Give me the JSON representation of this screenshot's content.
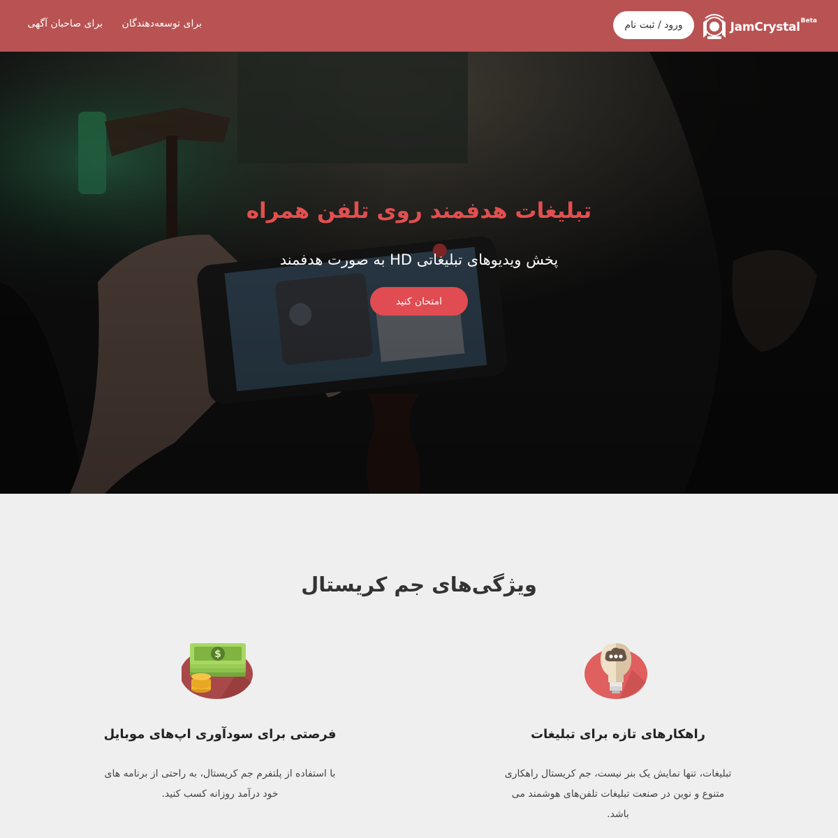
{
  "header": {
    "brand_name": "JamCrystal",
    "brand_badge": "Beta",
    "login_label": "ورود / ثبت نام",
    "nav": [
      {
        "label": "برای توسعه‌دهندگان"
      },
      {
        "label": "برای صاحبان آگهی"
      }
    ]
  },
  "hero": {
    "title": "تبلیغات هدفمند روی تلفن همراه",
    "subtitle": "پخش ویدیوهای تبلیغاتی HD به صورت هدفمند",
    "cta_label": "امتحان کنید"
  },
  "features": {
    "title": "ویژگی‌های جم کریستال",
    "items": [
      {
        "icon": "lightbulb-icon",
        "title": "راهکارهای تازه برای تبلیغات",
        "text": "تبلیغات، تنها نمایش یک بنر نیست، جم کریستال راهکاری متنوع و نوین در صنعت تبلیغات تلفن‌های هوشمند می باشد."
      },
      {
        "icon": "money-icon",
        "title": "فرصتی برای سودآوری اپ‌های موبایل",
        "text": "با استفاده از پلتفرم جم کریستال، به راحتی از برنامه های خود درآمد روزانه کسب کنید."
      }
    ]
  },
  "colors": {
    "header_bg": "#b95353",
    "hero_title": "#e24f4f",
    "cta_bg": "#e04c51",
    "page_bg": "#efefef"
  }
}
